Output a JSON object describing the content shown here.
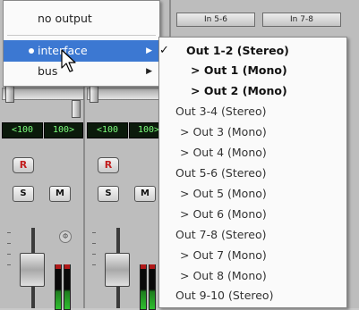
{
  "inserts": {
    "in_5_6": "In 5-6",
    "in_7_8": "In 7-8"
  },
  "lcd": [
    "<100",
    "100>",
    "<100",
    "100>"
  ],
  "strip_buttons": {
    "rec": "R",
    "solo": "S",
    "mute": "M"
  },
  "pan_symbol": "Φ",
  "output_menu": {
    "no_output": "no output",
    "interface": "interface",
    "bus": "bus"
  },
  "interface_submenu": {
    "selected_check": "✓",
    "items": [
      "Out 1-2 (Stereo)",
      "> Out 1 (Mono)",
      "> Out 2 (Mono)",
      "Out 3-4 (Stereo)",
      "> Out 3 (Mono)",
      "> Out 4 (Mono)",
      "Out 5-6 (Stereo)",
      "> Out 5 (Mono)",
      "> Out 6 (Mono)",
      "Out 7-8 (Stereo)",
      "> Out 7 (Mono)",
      "> Out 8 (Mono)",
      "Out 9-10 (Stereo)"
    ]
  },
  "colors": {
    "highlight": "#3c78d2",
    "menu_bg": "#fafafa",
    "lcd_text": "#7dff7d",
    "rec_red": "#c21e1e"
  },
  "icons": [
    "arrow-cursor-icon",
    "submenu-arrow-icon",
    "radio-dot-icon",
    "checkmark-icon"
  ]
}
